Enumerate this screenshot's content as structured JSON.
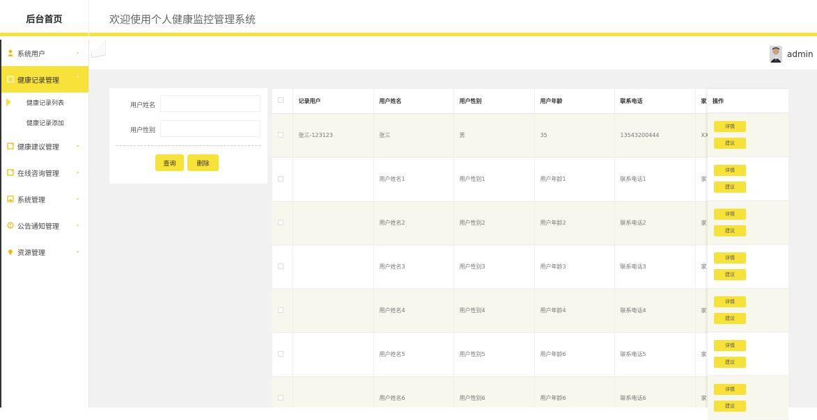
{
  "header": {
    "logo": "后台首页",
    "title": "欢迎使用个人健康监控管理系统"
  },
  "user": {
    "name": "admin"
  },
  "sidebar": {
    "items": [
      {
        "label": "系统用户",
        "icon": "user-icon",
        "active": false
      },
      {
        "label": "健康记录管理",
        "icon": "note-icon",
        "active": true
      },
      {
        "label": "健康建议管理",
        "icon": "note-icon",
        "active": false
      },
      {
        "label": "在线咨询管理",
        "icon": "note-icon",
        "active": false
      },
      {
        "label": "系统管理",
        "icon": "image-icon",
        "active": false
      },
      {
        "label": "公告通知管理",
        "icon": "info-icon",
        "active": false
      },
      {
        "label": "资源管理",
        "icon": "pin-icon",
        "active": false
      }
    ],
    "subitems": [
      {
        "label": "健康记录列表"
      },
      {
        "label": "健康记录添加"
      }
    ]
  },
  "search": {
    "name_label": "用户姓名",
    "gender_label": "用户性别",
    "query_button": "查询",
    "delete_button": "删除"
  },
  "table": {
    "columns": [
      "记录用户",
      "用户姓名",
      "用户性别",
      "用户年龄",
      "联系电话",
      "家"
    ],
    "op_header": "操作",
    "detail_button": "详情",
    "advice_button": "建议",
    "rows": [
      [
        "张三-123123",
        "张三",
        "男",
        "35",
        "13543200444",
        "XX"
      ],
      [
        "",
        "用户姓名1",
        "用户性别1",
        "用户年龄1",
        "联系电话1",
        "家"
      ],
      [
        "",
        "用户姓名2",
        "用户性别2",
        "用户年龄2",
        "联系电话2",
        "家"
      ],
      [
        "",
        "用户姓名3",
        "用户性别3",
        "用户年龄3",
        "联系电话3",
        "家"
      ],
      [
        "",
        "用户姓名4",
        "用户性别4",
        "用户年龄4",
        "联系电话4",
        "家"
      ],
      [
        "",
        "用户姓名5",
        "用户性别5",
        "用户年龄6",
        "联系电话5",
        "家"
      ],
      [
        "",
        "用户姓名6",
        "用户性别6",
        "用户年龄6",
        "联系电话6",
        "家"
      ]
    ]
  },
  "colors": {
    "accent": "#f7e23a",
    "row_alt": "#f7f7ee"
  }
}
